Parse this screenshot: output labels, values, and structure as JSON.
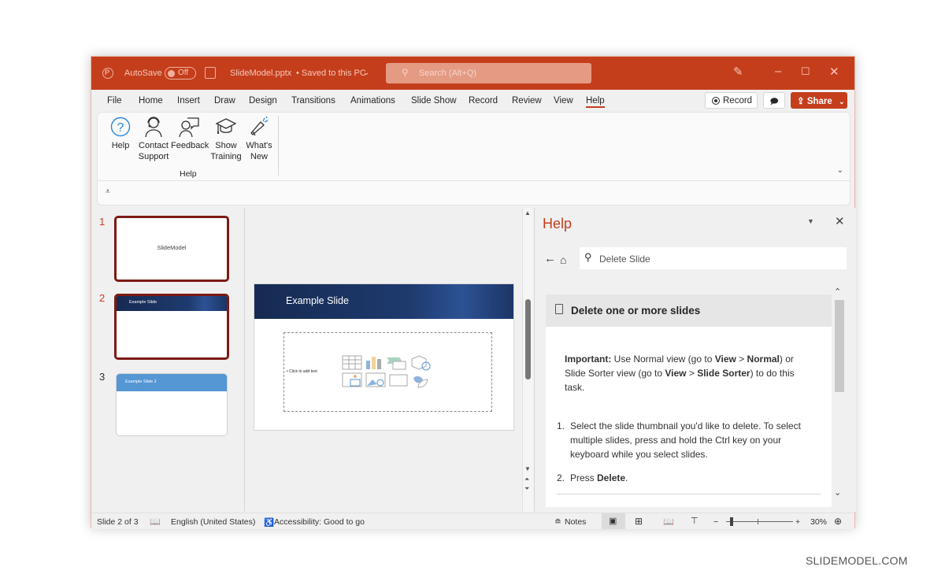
{
  "titlebar": {
    "autosave_label": "AutoSave",
    "autosave_state": "Off",
    "filename": "SlideModel.pptx",
    "save_status": "• Saved to this PC",
    "search_placeholder": "Search (Alt+Q)",
    "colors": {
      "accent": "#c43e1c"
    }
  },
  "menu": {
    "tabs": [
      "File",
      "Home",
      "Insert",
      "Draw",
      "Design",
      "Transitions",
      "Animations",
      "Slide Show",
      "Record",
      "Review",
      "View",
      "Help"
    ],
    "active_tab": "Help",
    "record_label": "Record",
    "share_label": "Share"
  },
  "ribbon": {
    "items": [
      {
        "label1": "Help",
        "label2": "",
        "icon": "question-circle-icon"
      },
      {
        "label1": "Contact",
        "label2": "Support",
        "icon": "headset-person-icon"
      },
      {
        "label1": "Feedback",
        "label2": "",
        "icon": "person-speech-icon"
      },
      {
        "label1": "Show",
        "label2": "Training",
        "icon": "graduation-cap-icon"
      },
      {
        "label1": "What's",
        "label2": "New",
        "icon": "megaphone-icon"
      }
    ],
    "group_label": "Help"
  },
  "slides_panel": {
    "slides": [
      {
        "number": "1",
        "title": "SlideModel",
        "selected": true
      },
      {
        "number": "2",
        "title": "Example Slide",
        "selected": true
      },
      {
        "number": "3",
        "title": "Example Slide 2",
        "selected": false
      }
    ]
  },
  "editor": {
    "slide_title": "Example Slide",
    "placeholder_text": "Click to add text"
  },
  "help_pane": {
    "title": "Help",
    "search_value": "Delete Slide",
    "article_title": "Delete one or more slides",
    "important_label": "Important:",
    "important_text_1": " Use Normal view (go to ",
    "view1": "View",
    "gt": " > ",
    "normal": "Normal",
    "important_text_2": ") or Slide Sorter view (go to ",
    "view2": "View",
    "slide_sorter": "Slide Sorter",
    "important_text_3": ") to do this task.",
    "steps": [
      {
        "n": "1.",
        "text": "Select the slide thumbnail you'd like to delete. To select multiple slides, press and hold the Ctrl key on your keyboard while you select slides."
      },
      {
        "n": "2.",
        "pre": "Press ",
        "bold": "Delete",
        "post": "."
      }
    ]
  },
  "statusbar": {
    "slide_info": "Slide 2 of 3",
    "language": "English (United States)",
    "accessibility": "Accessibility: Good to go",
    "notes_label": "Notes",
    "zoom_level": "30%",
    "zoom_minus": "−",
    "zoom_plus": "+"
  },
  "watermark": "SLIDEMODEL.COM"
}
